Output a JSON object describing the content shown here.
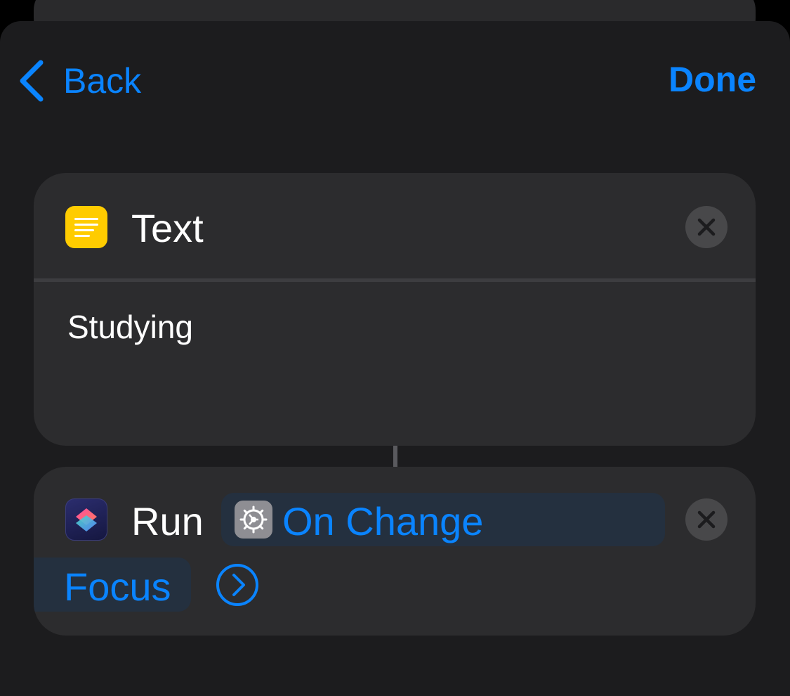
{
  "nav": {
    "back_label": "Back",
    "done_label": "Done"
  },
  "text_action": {
    "title": "Text",
    "icon": "text-lines-icon",
    "value": "Studying"
  },
  "run_action": {
    "title": "Run",
    "icon": "shortcuts-icon",
    "shortcut_icon": "gear-icon",
    "shortcut_name": "On Change",
    "parameter": "Focus",
    "expand_icon": "chevron-right-circle-icon"
  },
  "colors": {
    "accent": "#0a84ff",
    "background": "#1c1c1e",
    "card": "#2c2c2e",
    "text_icon_bg": "#ffcc00"
  }
}
